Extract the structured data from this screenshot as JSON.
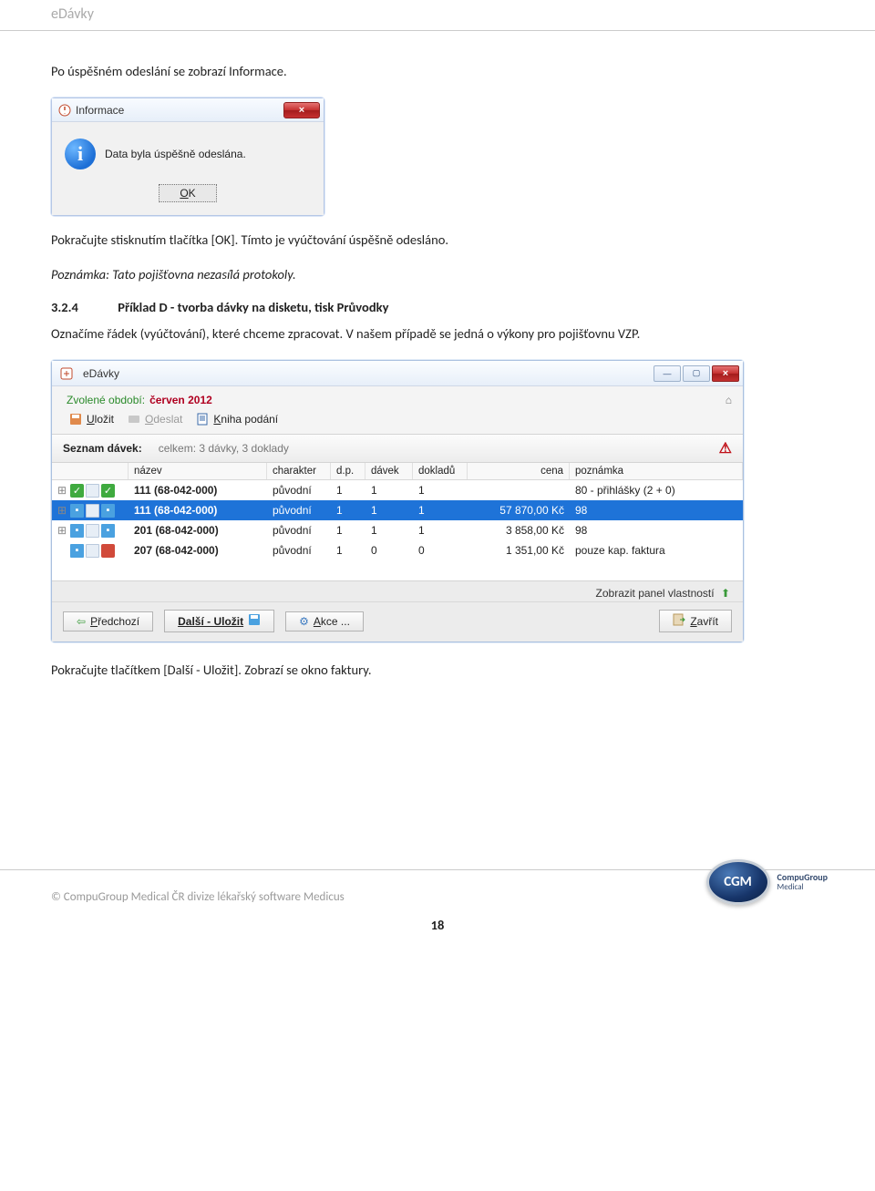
{
  "header": {
    "title": "eDávky"
  },
  "paragraphs": {
    "p1": "Po úspěšném odeslání se zobrazí Informace.",
    "p2": "Pokračujte stisknutím tlačítka [OK]. Tímto je vyúčtování úspěšně odesláno.",
    "note": "Poznámka: Tato pojišťovna nezasílá protokoly.",
    "sect_num": "3.2.4",
    "sect_title": "Příklad D - tvorba dávky na disketu, tisk Průvodky",
    "p3": "Označíme řádek (vyúčtování), které chceme zpracovat. V našem případě se jedná o výkony pro pojišťovnu VZP.",
    "p4": "Pokračujte tlačítkem [Další - Uložit]. Zobrazí se okno faktury."
  },
  "dialog": {
    "title": "Informace",
    "close": "×",
    "icon_letter": "i",
    "message": "Data byla úspěšně odeslána.",
    "ok_prefix": "O",
    "ok_rest": "K"
  },
  "app": {
    "title": "eDávky",
    "period_label": "Zvolené období:",
    "period_value": "červen 2012",
    "home_glyph": "⌂",
    "toolbar": {
      "save_u": "U",
      "save_rest": "ložit",
      "send_u": "O",
      "send_rest": "deslat",
      "book_u": "K",
      "book_rest": "niha podání"
    },
    "list_header": "Seznam dávek:",
    "list_summary": "celkem: 3 dávky, 3 doklady",
    "warn_glyph": "⚠",
    "columns": {
      "name": "název",
      "char": "charakter",
      "dp": "d.p.",
      "davek": "dávek",
      "dokl": "dokladů",
      "cena": "cena",
      "pozn": "poznámka"
    },
    "rows": [
      {
        "name": "111 (68-042-000)",
        "char": "původní",
        "dp": "1",
        "davek": "1",
        "dokl": "1",
        "cena": "",
        "pozn": "80 - přihlášky (2 + 0)"
      },
      {
        "name": "111 (68-042-000)",
        "char": "původní",
        "dp": "1",
        "davek": "1",
        "dokl": "1",
        "cena": "57 870,00 Kč",
        "pozn": "98"
      },
      {
        "name": "201 (68-042-000)",
        "char": "původní",
        "dp": "1",
        "davek": "1",
        "dokl": "1",
        "cena": "3 858,00 Kč",
        "pozn": "98"
      },
      {
        "name": "207 (68-042-000)",
        "char": "původní",
        "dp": "1",
        "davek": "0",
        "dokl": "0",
        "cena": "1 351,00 Kč",
        "pozn": "pouze kap. faktura"
      }
    ],
    "prop_panel": "Zobrazit panel vlastností",
    "buttons": {
      "prev_u": "P",
      "prev_rest": "ředchozí",
      "next": "Další - Uložit",
      "akce_u": "A",
      "akce_rest": "kce ...",
      "close_u": "Z",
      "close_rest": "avřít"
    }
  },
  "footer": {
    "copyright": "© CompuGroup Medical ČR divize lékařský software Medicus",
    "page": "18",
    "logo_text": "CGM",
    "logo_line1": "CompuGroup",
    "logo_line2": "Medical"
  }
}
